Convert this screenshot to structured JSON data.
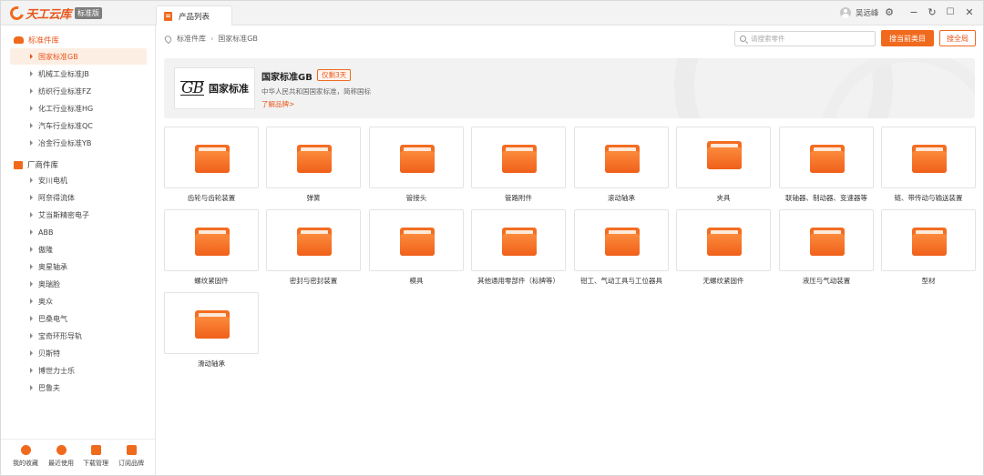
{
  "app": {
    "logo_text": "天工云库",
    "edition_badge": "标准版",
    "tab_label": "产品列表",
    "user_name": "吴远峰",
    "accent_color": "#f06a1e"
  },
  "window_controls": [
    "settings-icon",
    "minimize-icon",
    "refresh-icon",
    "maximize-icon",
    "close-icon"
  ],
  "sidebar": {
    "group1": {
      "title": "标准件库",
      "items": [
        "国家标准GB",
        "机械工业标准JB",
        "纺织行业标准FZ",
        "化工行业标准HG",
        "汽车行业标准QC",
        "冶金行业标准YB"
      ],
      "active_index": 0
    },
    "group2": {
      "title": "厂商件库",
      "items": [
        "安川电机",
        "阿奈得流体",
        "艾当斯精密电子",
        "ABB",
        "傲隆",
        "奥星轴承",
        "奥瑞脸",
        "奥众",
        "巴桑电气",
        "宝奇环形导轨",
        "贝斯特",
        "博世力士乐",
        "巴鲁夫"
      ]
    },
    "bottom": [
      "我的收藏",
      "最近使用",
      "下载管理",
      "订阅品牌"
    ]
  },
  "main": {
    "breadcrumb": [
      "标准件库",
      "国家标准GB"
    ],
    "search_placeholder": "请搜索零件",
    "search_current_btn": "搜当前类目",
    "search_all_btn": "搜全局",
    "brand": {
      "logo_mark": "GB",
      "logo_text": "国家标准",
      "title": "国家标准GB",
      "tag": "仅剩3天",
      "description": "中华人民共和国国家标准，简称国标",
      "link": "了解品牌>"
    },
    "categories": [
      "齿轮与齿轮装置",
      "弹簧",
      "管接头",
      "管路附件",
      "滚动轴承",
      "夹具",
      "联轴器、制动器、变速器等",
      "链、带传动与输送装置",
      "螺纹紧固件",
      "密封与密封装置",
      "模具",
      "其他通用零部件（标牌等）",
      "钳工、气动工具与工位器具",
      "无螺纹紧固件",
      "液压与气动装置",
      "型材",
      "滑动轴承"
    ]
  }
}
